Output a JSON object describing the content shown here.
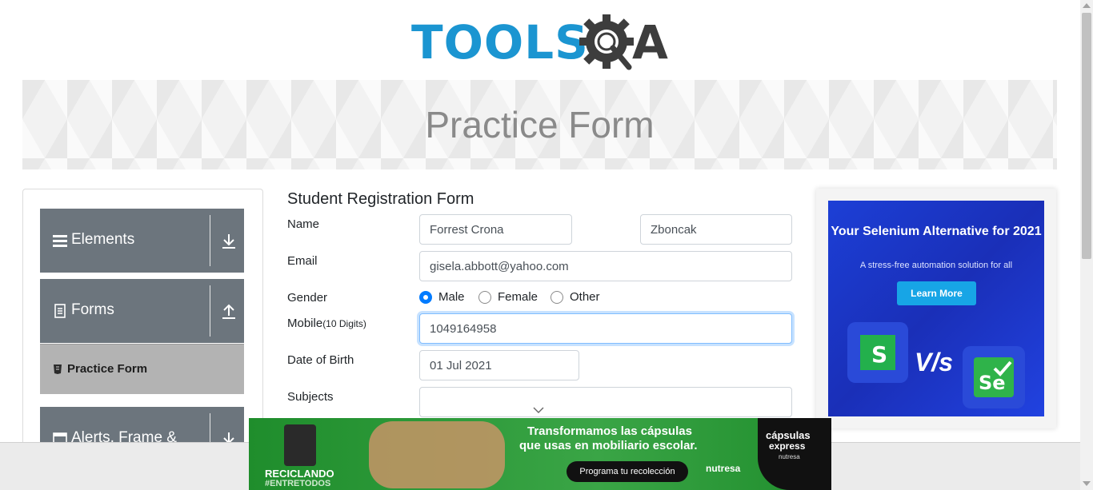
{
  "logo": {
    "part1": "TOOLS",
    "part2": "A"
  },
  "banner": {
    "title": "Practice Form"
  },
  "sidebar": {
    "groups": [
      {
        "label": "Elements",
        "icon": "list-icon"
      },
      {
        "label": "Forms",
        "icon": "document-icon"
      },
      {
        "label": "Alerts, Frame & ",
        "icon": "window-icon"
      }
    ],
    "active_item": {
      "label": "Practice Form",
      "icon": "form-icon"
    }
  },
  "form": {
    "title": "Student Registration Form",
    "name": {
      "label": "Name",
      "first": "Forrest Crona",
      "last": "Zboncak"
    },
    "email": {
      "label": "Email",
      "value": "gisela.abbott@yahoo.com"
    },
    "gender": {
      "label": "Gender",
      "options": [
        "Male",
        "Female",
        "Other"
      ],
      "selected": "Male"
    },
    "mobile": {
      "label": "Mobile",
      "hint": "(10 Digits)",
      "value": "1049164958"
    },
    "dob": {
      "label": "Date of Birth",
      "value": "01 Jul 2021"
    },
    "subjects": {
      "label": "Subjects",
      "value": ""
    }
  },
  "right_ad": {
    "title": "Your Selenium Alternative for 2021",
    "subtitle": "A stress-free automation solution for all",
    "button": "Learn More",
    "vs": "V/s",
    "left_logo": "S",
    "right_logo": "Se"
  },
  "bottom_ad": {
    "headline1": "Transformamos las cápsulas",
    "headline2": "que usas en mobiliario escolar.",
    "button": "Programa tu recolección",
    "left1": "RECICLANDO",
    "left2": "#ENTRETODOS",
    "right1": "cápsulas",
    "right2": "express",
    "right3": "nutresa",
    "logo": "nutresa"
  },
  "colors": {
    "accent": "#007bff",
    "sidebar_header": "#6c757d",
    "sidebar_active": "#b3b3b3",
    "logo_blue": "#1b95d1"
  }
}
